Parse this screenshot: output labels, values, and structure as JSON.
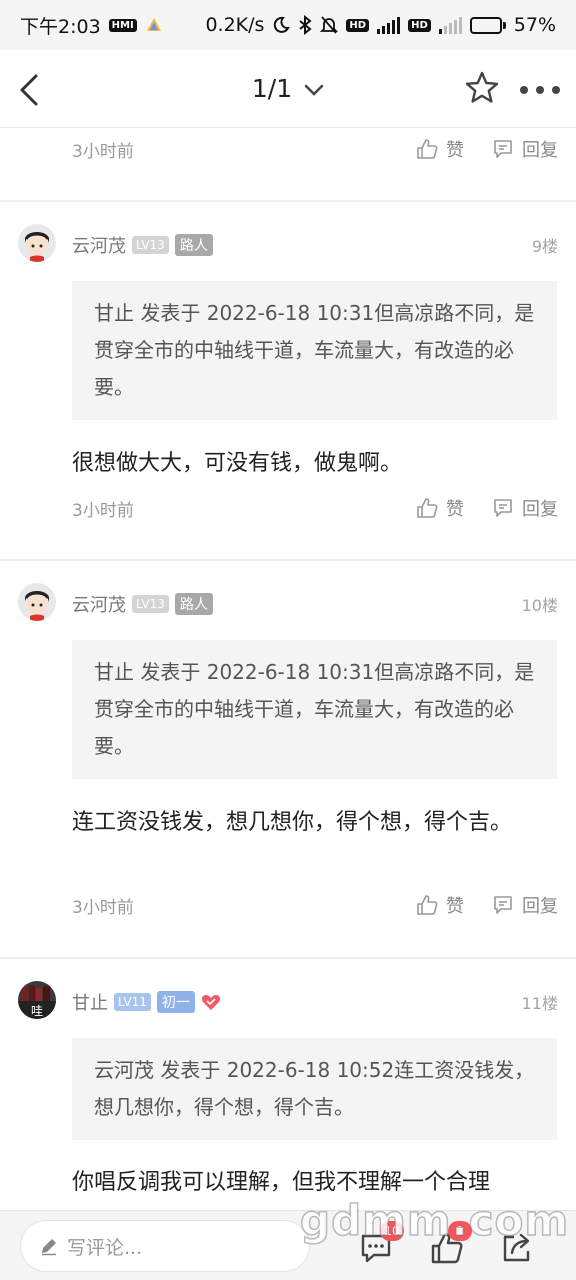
{
  "status_bar": {
    "time": "下午2:03",
    "speed": "0.2K/s",
    "battery": "57%",
    "battery_level": 0.57
  },
  "nav": {
    "page_indicator": "1/1"
  },
  "actions": {
    "like_label": "赞",
    "reply_label": "回复"
  },
  "prev_comment": {
    "time": "3小时前"
  },
  "comments": [
    {
      "user": "云河茂",
      "level": "LV13",
      "tag": "路人",
      "floor": "9楼",
      "quote": "甘止 发表于 2022-6-18 10:31但高凉路不同，是贯穿全市的中轴线干道，车流量大，有改造的必要。",
      "body": "很想做大大，可没有钱，做鬼啊。",
      "time": "3小时前"
    },
    {
      "user": "云河茂",
      "level": "LV13",
      "tag": "路人",
      "floor": "10楼",
      "quote": "甘止 发表于 2022-6-18 10:31但高凉路不同，是贯穿全市的中轴线干道，车流量大，有改造的必要。",
      "body": "连工资没钱发，想几想你，得个想，得个吉。",
      "time": "3小时前"
    },
    {
      "user": "甘止",
      "level": "LV11",
      "tag": "初一",
      "floor": "11楼",
      "avatar_text": "哇",
      "quote": "云河茂 发表于 2022-6-18 10:52连工资没钱发，想几想你，得个想，得个吉。",
      "body": "你唱反调我可以理解，但我不理解一个合理"
    }
  ],
  "bottom_bar": {
    "comment_placeholder": "写评论...",
    "comment_count": "10",
    "like_count": "1"
  },
  "watermark": "gdmm.com",
  "colors": {
    "accent_badge": "#f2555a",
    "level_gray": "#d4d4d4",
    "level_blue": "#a6c4ee",
    "heart": "#f05a6a"
  }
}
